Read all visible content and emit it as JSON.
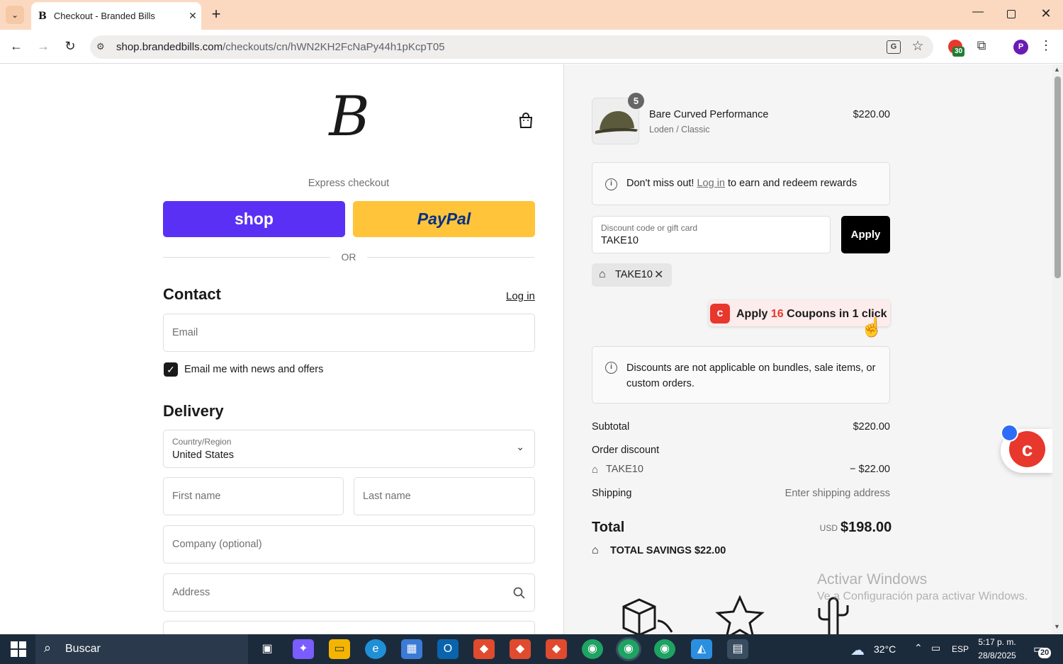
{
  "browser": {
    "tab_title": "Checkout - Branded Bills",
    "tab_favicon": "B",
    "url_host": "shop.brandedbills.com",
    "url_path": "/checkouts/cn/hWN2KH2FcNaPy44h1pKcpT05",
    "extension_badge": "30",
    "profile_initial": "P"
  },
  "checkout": {
    "logo": "B",
    "express_label": "Express checkout",
    "shop_pay_label": "shop",
    "paypal_label": "PayPal",
    "or_label": "OR",
    "contact_heading": "Contact",
    "login_link": "Log in",
    "email_placeholder": "Email",
    "newsletter_label": "Email me with news and offers",
    "newsletter_checked": true,
    "delivery_heading": "Delivery",
    "country_label": "Country/Region",
    "country_value": "United States",
    "first_name_placeholder": "First name",
    "last_name_placeholder": "Last name",
    "company_placeholder": "Company (optional)",
    "address_placeholder": "Address"
  },
  "summary": {
    "product_name": "Bare Curved Performance",
    "product_variant": "Loden / Classic",
    "product_qty": "5",
    "product_price": "$220.00",
    "rewards_pre": "Don't miss out!",
    "rewards_link": "Log in",
    "rewards_post": "to earn and redeem rewards",
    "discount_label": "Discount code or gift card",
    "discount_value": "TAKE10",
    "apply_label": "Apply",
    "applied_code": "TAKE10",
    "coupon_pre": "Apply",
    "coupon_count": "16",
    "coupon_post": "Coupons in 1 click",
    "notice_text": "Discounts are not applicable on bundles, sale items, or custom orders.",
    "subtotal_label": "Subtotal",
    "subtotal_value": "$220.00",
    "order_discount_label": "Order discount",
    "discount_code_line": "TAKE10",
    "discount_amount": "− $22.00",
    "shipping_label": "Shipping",
    "shipping_value": "Enter shipping address",
    "total_label": "Total",
    "currency": "USD",
    "total_value": "$198.00",
    "savings_label": "TOTAL SAVINGS",
    "savings_value": "$22.00"
  },
  "watermark": {
    "line1": "Activar Windows",
    "line2": "Ve a Configuración para activar Windows."
  },
  "taskbar": {
    "search_placeholder": "Buscar",
    "weather": "32°C",
    "language": "ESP",
    "time": "5:17 p. m.",
    "date": "28/8/2025",
    "notifications": "20"
  },
  "colors": {
    "titlebar": "#fbd9c0",
    "shop_pay": "#5a31f4",
    "paypal": "#ffc439",
    "coupon_red": "#e8372c",
    "taskbar": "#1c2b3c"
  }
}
